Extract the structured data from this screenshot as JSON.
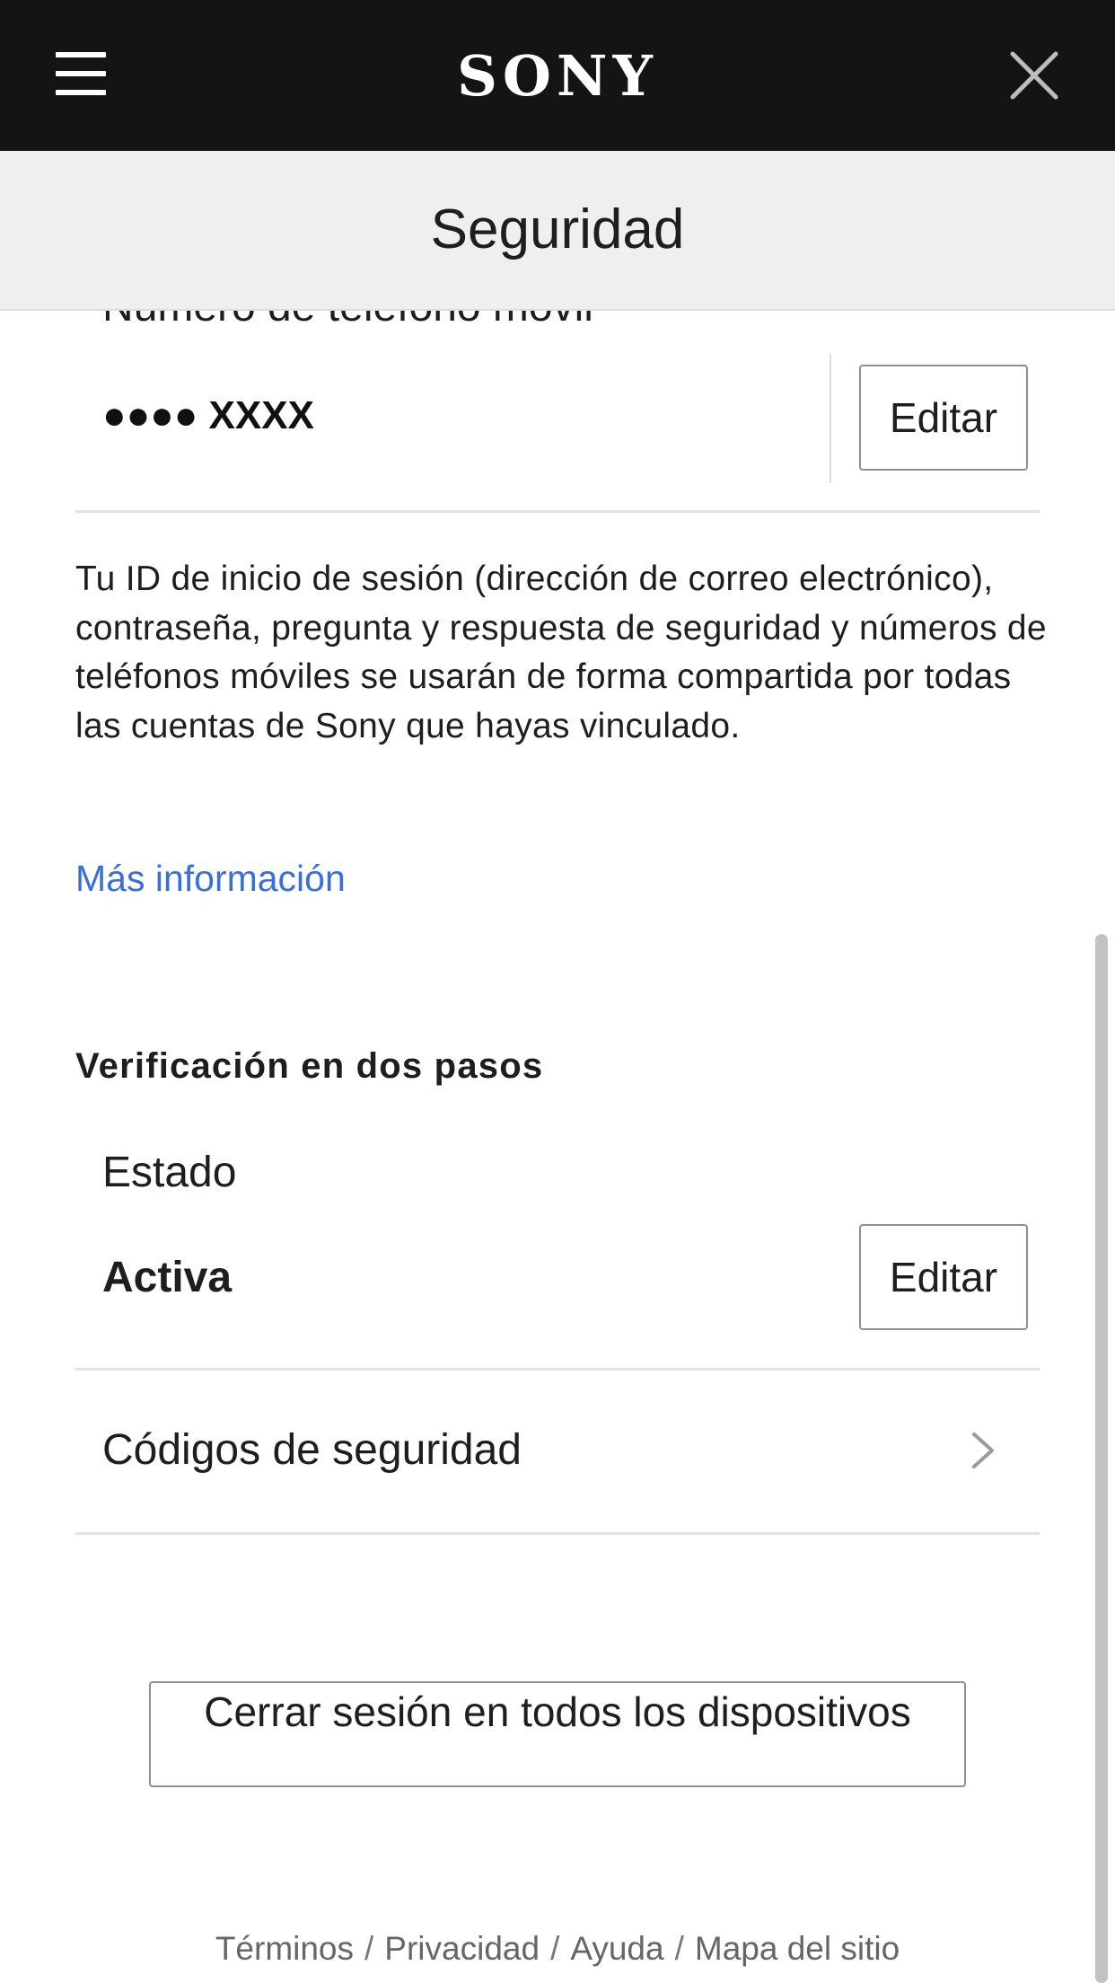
{
  "header": {
    "logo_text": "SONY",
    "menu_icon": "hamburger-menu-icon",
    "close_icon": "close-icon"
  },
  "page": {
    "title": "Seguridad"
  },
  "phone": {
    "label": "Número de teléfono móvil",
    "value": "●●●● XXXX",
    "edit_label": "Editar"
  },
  "info": {
    "paragraph": "Tu ID de inicio de sesión (dirección de correo electrónico), contraseña, pregunta y respuesta de seguridad y números de teléfonos móviles se usarán de forma compartida por todas las cuentas de Sony que hayas vinculado.",
    "more_link": "Más información",
    "link_color": "#3a6fd8"
  },
  "two_step": {
    "heading": "Verificación en dos pasos",
    "status_label": "Estado",
    "status_value": "Activa",
    "edit_label": "Editar",
    "codes_label": "Códigos de seguridad",
    "codes_icon": "chevron-right-icon"
  },
  "actions": {
    "signout_all": "Cerrar sesión en todos los dispositivos"
  },
  "footer": {
    "links": [
      "Términos",
      "Privacidad",
      "Ayuda",
      "Mapa del sitio"
    ],
    "separator": "/"
  }
}
